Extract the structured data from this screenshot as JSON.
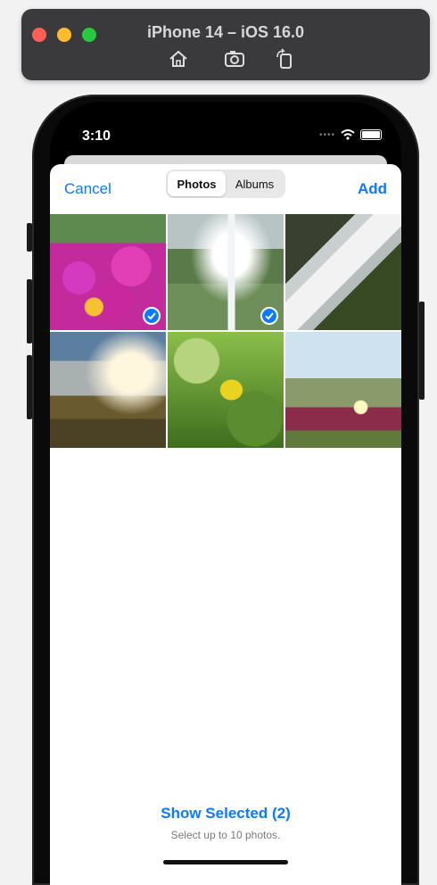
{
  "simulator": {
    "title": "iPhone 14 – iOS 16.0",
    "toolbar": [
      "home-icon",
      "screenshot-icon",
      "rotate-icon"
    ]
  },
  "status_bar": {
    "time": "3:10"
  },
  "nav": {
    "cancel": "Cancel",
    "add": "Add",
    "segments": [
      {
        "label": "Photos",
        "active": true
      },
      {
        "label": "Albums",
        "active": false
      }
    ]
  },
  "photos": [
    {
      "subject": "pink flowers",
      "selected": true
    },
    {
      "subject": "waterfall in mist",
      "selected": true
    },
    {
      "subject": "rushing water over rocks",
      "selected": false
    },
    {
      "subject": "waterfall canyon",
      "selected": false
    },
    {
      "subject": "yellow leaf",
      "selected": false
    },
    {
      "subject": "coastal flowers",
      "selected": false
    }
  ],
  "footer": {
    "show_selected": "Show Selected (2)",
    "hint": "Select up to 10 photos."
  },
  "colors": {
    "accent": "#0a7aff"
  }
}
